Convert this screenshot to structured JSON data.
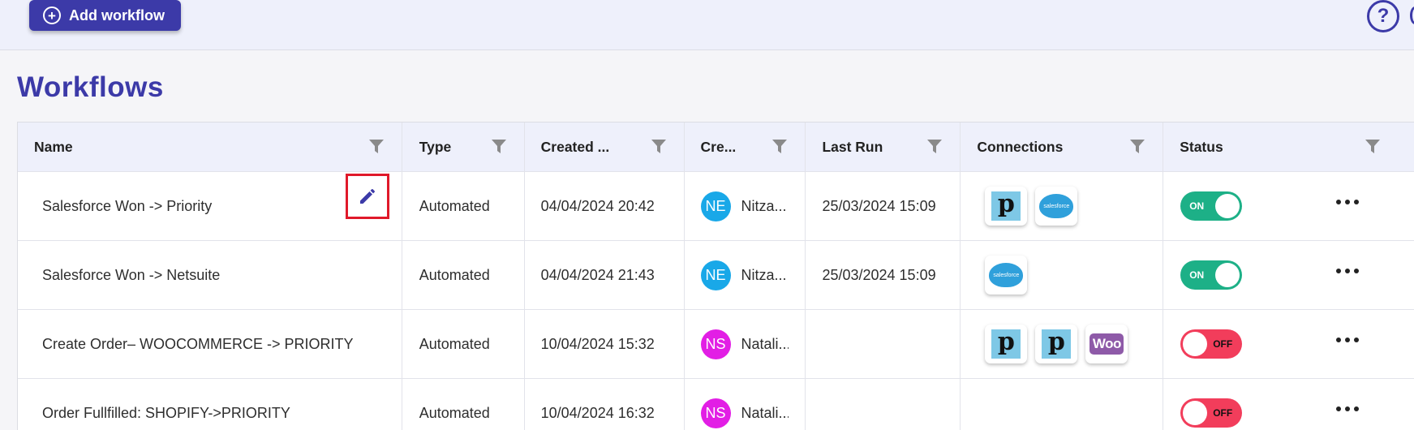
{
  "header": {
    "add_button_label": "Add workflow",
    "help_icon": "question-circle-icon"
  },
  "page_title": "Workflows",
  "table": {
    "columns": [
      "Name",
      "Type",
      "Created ...",
      "Cre...",
      "Last Run",
      "Connections",
      "Status"
    ],
    "rows": [
      {
        "name": "Salesforce Won -> Priority",
        "type": "Automated",
        "created": "04/04/2024 20:42",
        "creator_initials": "NE",
        "creator_name": "Nitza...",
        "avatar_color": "#19a8e8",
        "last_run": "25/03/2024 15:09",
        "connections": [
          "p",
          "salesforce"
        ],
        "status": "ON",
        "status_on": true
      },
      {
        "name": "Salesforce Won -> Netsuite",
        "type": "Automated",
        "created": "04/04/2024 21:43",
        "creator_initials": "NE",
        "creator_name": "Nitza...",
        "avatar_color": "#19a8e8",
        "last_run": "25/03/2024 15:09",
        "connections": [
          "salesforce"
        ],
        "status": "ON",
        "status_on": true
      },
      {
        "name": "Create Order– WOOCOMMERCE -> PRIORITY",
        "type": "Automated",
        "created": "10/04/2024 15:32",
        "creator_initials": "NS",
        "creator_name": "Natali...",
        "avatar_color": "#e21ee5",
        "last_run": "",
        "connections": [
          "p",
          "p",
          "Woo"
        ],
        "status": "OFF",
        "status_on": false
      },
      {
        "name": "Order Fullfilled: SHOPIFY->PRIORITY",
        "type": "Automated",
        "created": "10/04/2024 16:32",
        "creator_initials": "NS",
        "creator_name": "Natali...",
        "avatar_color": "#e21ee5",
        "last_run": "",
        "connections": [],
        "status": "OFF",
        "status_on": false
      }
    ]
  },
  "colors": {
    "accent": "#3c3aa8",
    "on": "#1db087",
    "off": "#f23d5b",
    "highlight": "#e0192a"
  }
}
